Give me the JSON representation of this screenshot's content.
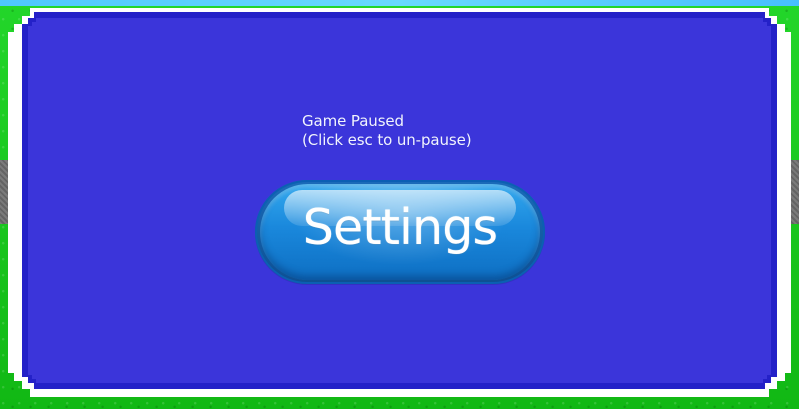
{
  "game": {
    "pause_title": "Game Paused",
    "pause_hint": "(Click esc to un-pause)",
    "settings_button_label": "Settings"
  },
  "colors": {
    "grass": "#18c81a",
    "panel": "#3b35da",
    "panel_border": "#2421c8",
    "button": "#1a88dc",
    "text": "#ffffff"
  }
}
